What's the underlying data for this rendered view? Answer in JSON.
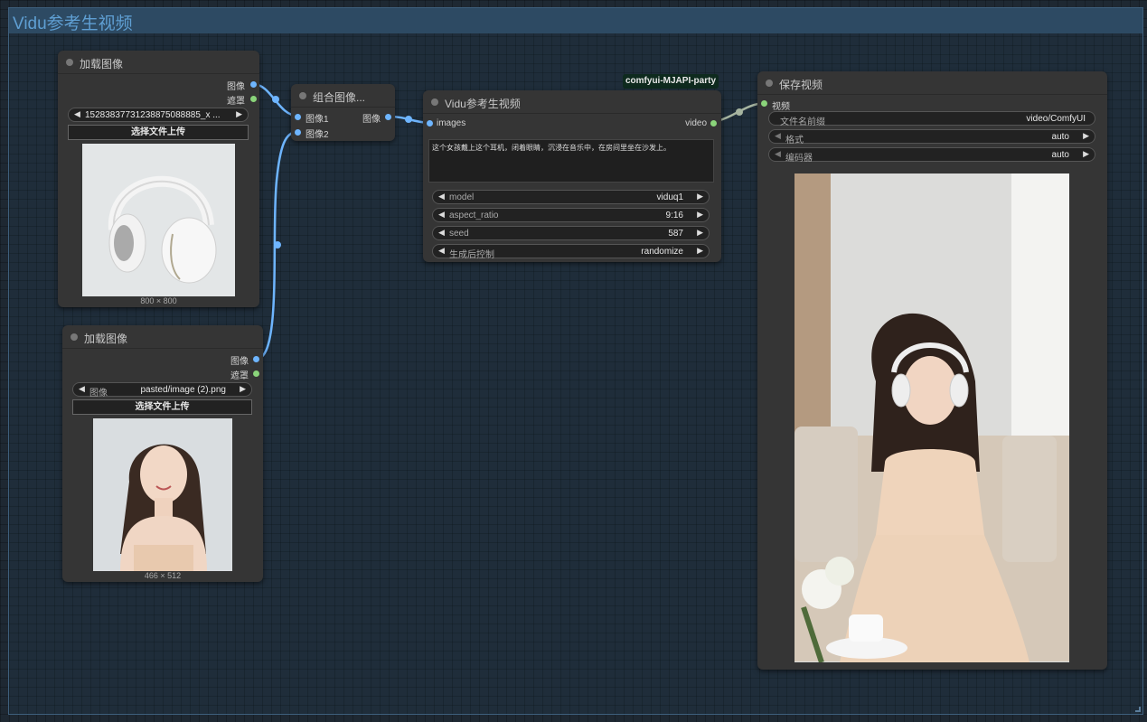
{
  "group": {
    "title": "Vidu参考生视频"
  },
  "badge": {
    "text": "comfyui-MJAPI-party"
  },
  "load_image_1": {
    "title": "加载图像",
    "outputs": [
      "图像",
      "遮罩"
    ],
    "image_value": "15283837731238875088885_x ...",
    "upload_label": "选择文件上传",
    "image_size": "800 × 800"
  },
  "load_image_2": {
    "title": "加载图像",
    "outputs": [
      "图像",
      "遮罩"
    ],
    "image_label": "图像",
    "image_value": "pasted/image (2).png",
    "upload_label": "选择文件上传",
    "image_size": "466 × 512"
  },
  "combine": {
    "title": "组合图像...",
    "inputs": [
      "图像1",
      "图像2"
    ],
    "output": "图像"
  },
  "vidu": {
    "title": "Vidu参考生视频",
    "input": "images",
    "output": "video",
    "prompt": "这个女孩戴上这个耳机，闭着眼睛，沉浸在音乐中，在房间里坐在沙发上。",
    "widgets": [
      {
        "label": "model",
        "value": "viduq1"
      },
      {
        "label": "aspect_ratio",
        "value": "9:16"
      },
      {
        "label": "seed",
        "value": "587"
      },
      {
        "label": "生成后控制",
        "value": "randomize"
      }
    ]
  },
  "save": {
    "title": "保存视频",
    "input": "视频",
    "widgets": [
      {
        "label": "文件名前缀",
        "value": "video/ComfyUI"
      },
      {
        "label": "格式",
        "value": "auto"
      },
      {
        "label": "编码器",
        "value": "auto"
      }
    ]
  },
  "colors": {
    "link_image": "#6eb5ff",
    "link_video": "#a6b4a0",
    "group_title": "#5f9fd3",
    "badge_bg": "#0e2a1e"
  }
}
